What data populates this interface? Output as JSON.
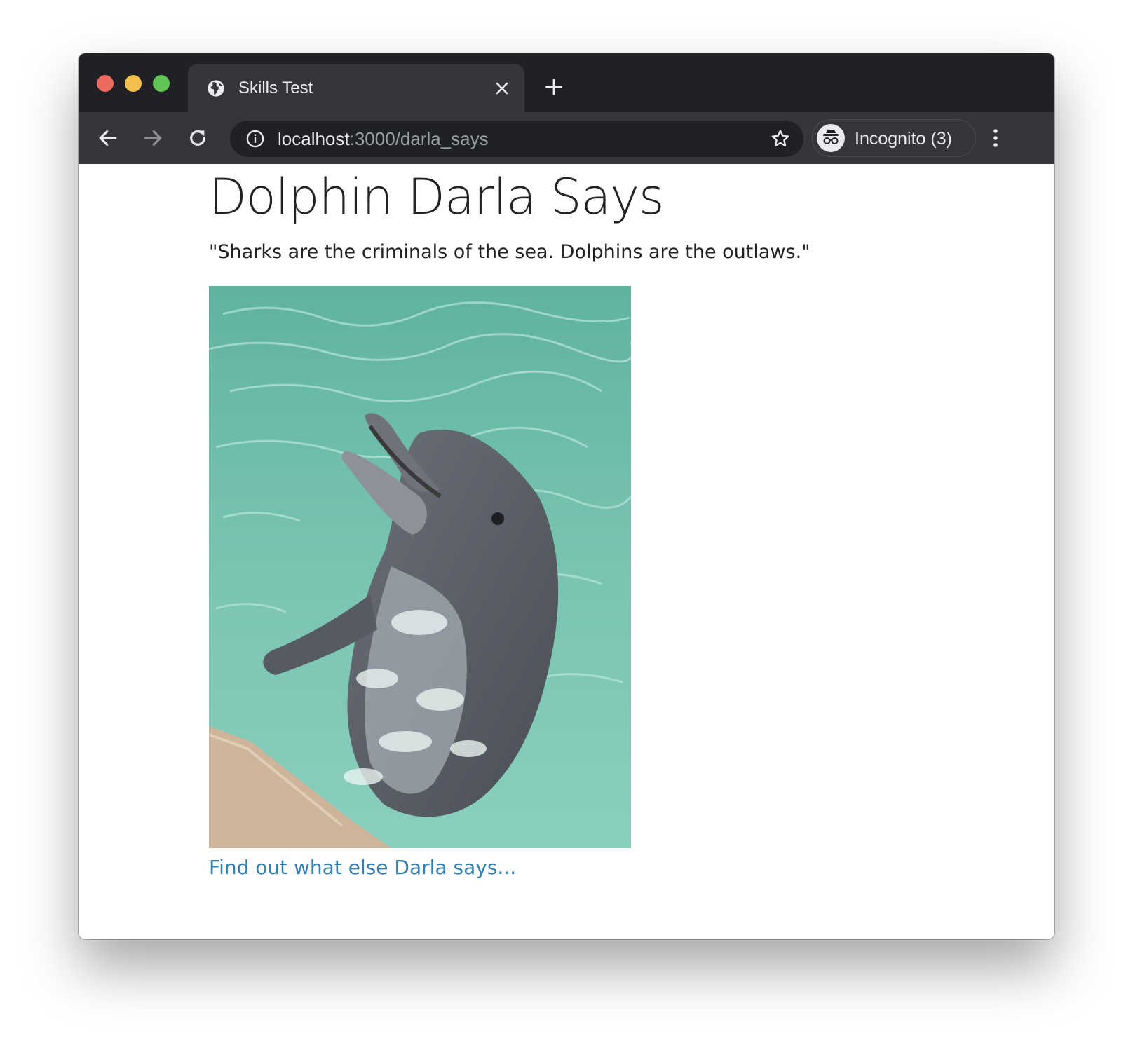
{
  "browser": {
    "tab": {
      "title": "Skills Test",
      "icon": "globe-icon"
    },
    "address_bar": {
      "host": "localhost",
      "path": ":3000/darla_says"
    },
    "profile": {
      "label": "Incognito (3)",
      "icon": "incognito-icon"
    },
    "colors": {
      "tabstrip": "#202124",
      "toolbar": "#35363a",
      "omnibox": "#202124",
      "close_dot": "#ed6a5e",
      "minimize_dot": "#f5bf4f",
      "zoom_dot": "#61c454"
    }
  },
  "page": {
    "title": "Dolphin Darla Says",
    "quote": "\"Sharks are the criminals of the sea. Dolphins are the outlaws.\"",
    "image_icon": "dolphin-photo",
    "link_text": "Find out what else Darla says...",
    "colors": {
      "text": "#222222",
      "link": "#2f7fb5"
    }
  }
}
